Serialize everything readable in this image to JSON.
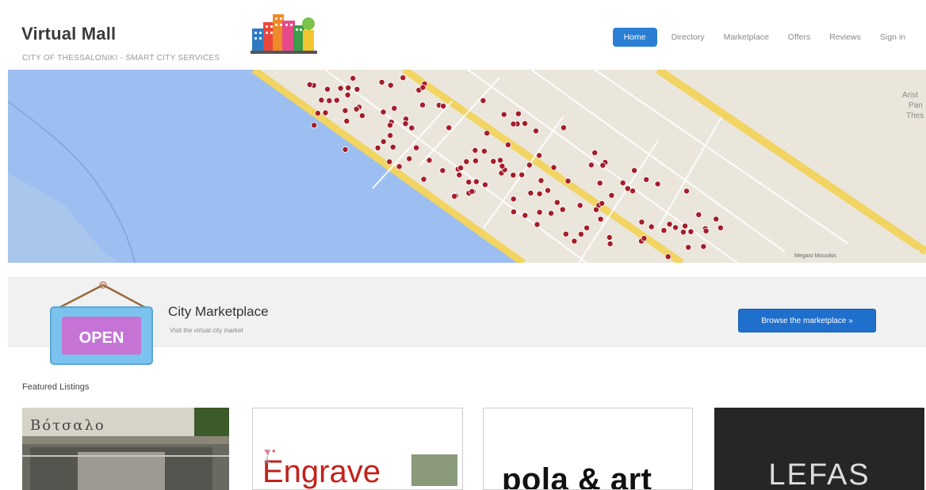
{
  "brand": {
    "title": "Virtual Mall",
    "subtitle": "CITY OF THESSALONIKI - SMART CITY SERVICES"
  },
  "nav": [
    {
      "label": "Home",
      "active": true
    },
    {
      "label": "Directory"
    },
    {
      "label": "Marketplace"
    },
    {
      "label": "Offers"
    },
    {
      "label": "Reviews"
    },
    {
      "label": "Sign in"
    }
  ],
  "map": {
    "labels": [
      "Megaro Mousikis",
      "Arist",
      "Pan",
      "Thes"
    ],
    "colors": {
      "sea": "#9dbef0",
      "land": "#ebe6dc",
      "road": "#f2d463",
      "pin": "#a41d2a"
    }
  },
  "jumbotron": {
    "title": "City Marketplace",
    "subtitle": "Visit the virtual city market",
    "sign_text": "OPEN",
    "button": "Browse the marketplace »"
  },
  "featured": {
    "heading": "Featured Listings",
    "cards": [
      {
        "title": "Βότσαλο"
      },
      {
        "title": "Engrave"
      },
      {
        "title": "pola & art"
      },
      {
        "title": "LEFAS"
      }
    ]
  }
}
